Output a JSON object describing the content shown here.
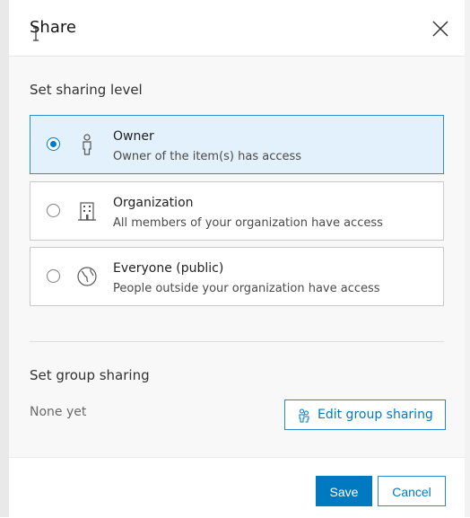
{
  "dialog": {
    "title": "Share",
    "close_icon": "close-icon"
  },
  "sharing_level": {
    "heading": "Set sharing level",
    "selected": "owner",
    "options": [
      {
        "id": "owner",
        "label": "Owner",
        "description": "Owner of the item(s) has access",
        "icon": "user-icon"
      },
      {
        "id": "organization",
        "label": "Organization",
        "description": "All members of your organization have access",
        "icon": "organization-icon"
      },
      {
        "id": "everyone",
        "label": "Everyone (public)",
        "description": "People outside your organization have access",
        "icon": "globe-icon"
      }
    ]
  },
  "group_sharing": {
    "heading": "Set group sharing",
    "empty_text": "None yet",
    "edit_button_label": "Edit group sharing",
    "edit_button_icon": "group-users-icon"
  },
  "footer": {
    "save_label": "Save",
    "cancel_label": "Cancel"
  },
  "colors": {
    "accent": "#0079c1",
    "selected_bg": "#e2f1fb",
    "selected_border": "#2b8dd4"
  }
}
